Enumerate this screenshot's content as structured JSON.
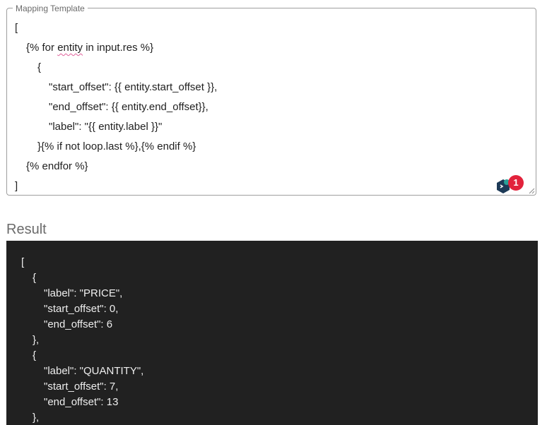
{
  "template": {
    "legend": "Mapping Template",
    "lines": [
      {
        "indent": 0,
        "text": "["
      },
      {
        "indent": 1,
        "pre": "{% for ",
        "squiggle": "entity",
        "post": " in input.res %}"
      },
      {
        "indent": 2,
        "text": "{"
      },
      {
        "indent": 3,
        "text": "\"start_offset\": {{ entity.start_offset }},"
      },
      {
        "indent": 3,
        "text": "\"end_offset\": {{ entity.end_offset}},"
      },
      {
        "indent": 3,
        "text": "\"label\": \"{{ entity.label }}\""
      },
      {
        "indent": 2,
        "text": "}{% if not loop.last %},{% endif %}"
      },
      {
        "indent": 1,
        "text": "{% endfor %}"
      },
      {
        "indent": 0,
        "text": "]"
      }
    ]
  },
  "assistant": {
    "icon": "assistant-logo-icon",
    "badge_count": "1",
    "badge_color": "#e2223b"
  },
  "result": {
    "heading": "Result",
    "lines": [
      {
        "indent": 0,
        "text": "["
      },
      {
        "indent": 1,
        "text": "{"
      },
      {
        "indent": 2,
        "text": "\"label\": \"PRICE\","
      },
      {
        "indent": 2,
        "text": "\"start_offset\": 0,"
      },
      {
        "indent": 2,
        "text": "\"end_offset\": 6"
      },
      {
        "indent": 1,
        "text": "},"
      },
      {
        "indent": 1,
        "text": "{"
      },
      {
        "indent": 2,
        "text": "\"label\": \"QUANTITY\","
      },
      {
        "indent": 2,
        "text": "\"start_offset\": 7,"
      },
      {
        "indent": 2,
        "text": "\"end_offset\": 13"
      },
      {
        "indent": 1,
        "text": "},"
      }
    ]
  }
}
